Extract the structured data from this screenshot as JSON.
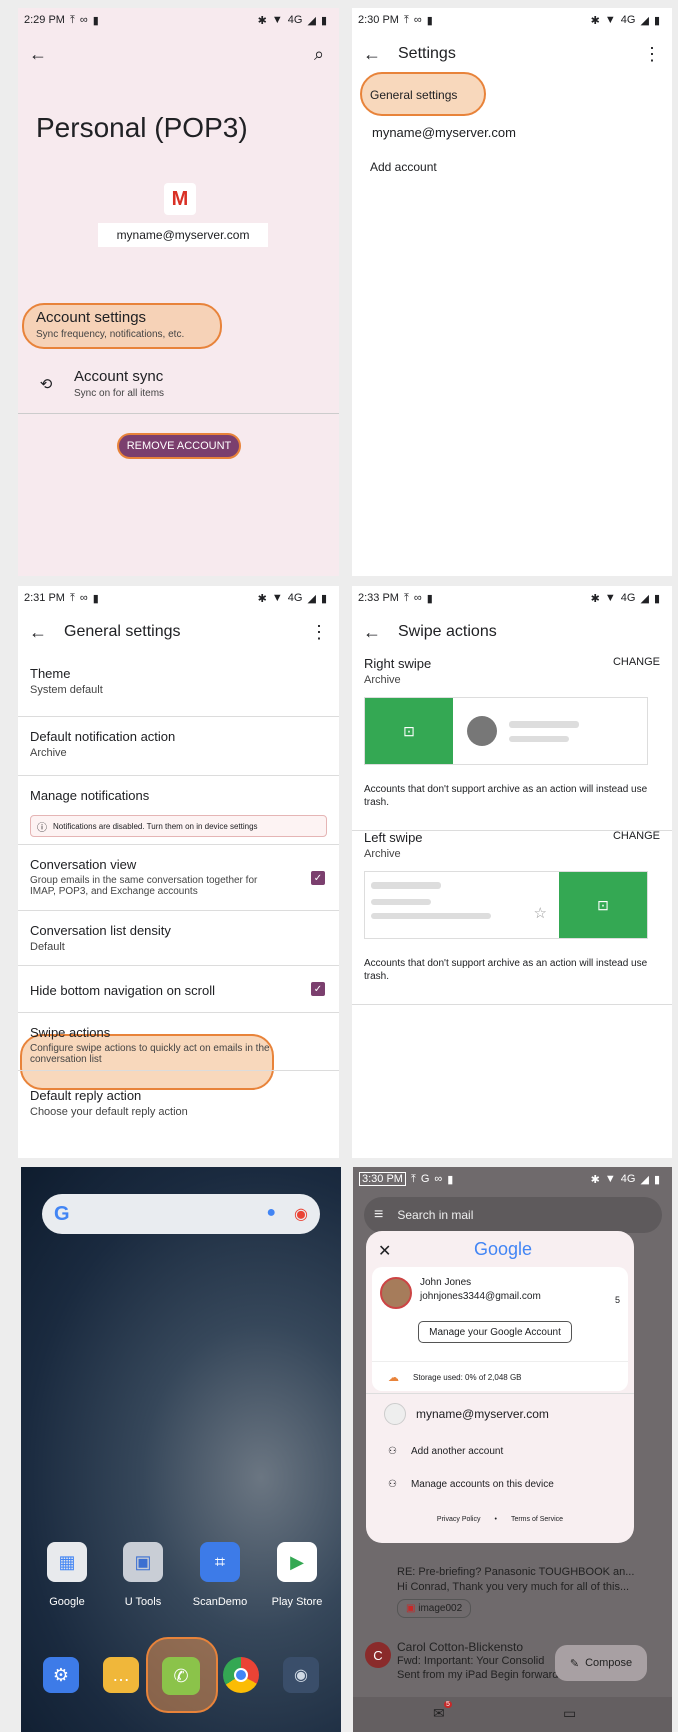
{
  "p1": {
    "time": "2:29 PM",
    "net": "4G",
    "title": "Personal (POP3)",
    "email": "myname@myserver.com",
    "acct_title": "Account settings",
    "acct_sub": "Sync frequency, notifications, etc.",
    "sync_title": "Account sync",
    "sync_sub": "Sync on for all items",
    "remove": "REMOVE ACCOUNT"
  },
  "p2": {
    "time": "2:30 PM",
    "net": "4G",
    "title": "Settings",
    "general": "General settings",
    "email": "myname@myserver.com",
    "add": "Add account"
  },
  "p3": {
    "time": "2:31 PM",
    "net": "4G",
    "title": "General settings",
    "theme": {
      "t": "Theme",
      "s": "System default"
    },
    "notif": {
      "t": "Default notification action",
      "s": "Archive"
    },
    "manage": {
      "t": "Manage notifications",
      "warn": "Notifications are disabled. Turn them on in device settings"
    },
    "conv": {
      "t": "Conversation view",
      "s": "Group emails in the same conversation together for IMAP, POP3, and Exchange accounts"
    },
    "density": {
      "t": "Conversation list density",
      "s": "Default"
    },
    "hide": {
      "t": "Hide bottom navigation on scroll"
    },
    "swipe": {
      "t": "Swipe actions",
      "s": "Configure swipe actions to quickly act on emails in the conversation list"
    },
    "reply": {
      "t": "Default reply action",
      "s": "Choose your default reply action"
    }
  },
  "p4": {
    "time": "2:33 PM",
    "net": "4G",
    "title": "Swipe actions",
    "right": {
      "t": "Right swipe",
      "s": "Archive",
      "change": "CHANGE",
      "note": "Accounts that don't support archive as an action will instead use trash."
    },
    "left": {
      "t": "Left swipe",
      "s": "Archive",
      "change": "CHANGE",
      "note": "Accounts that don't support archive as an action will instead use trash."
    }
  },
  "p5": {
    "apps": [
      "Google",
      "U Tools",
      "ScanDemo",
      "Play Store"
    ]
  },
  "p6": {
    "time": "3:30 PM",
    "net": "4G",
    "search": "Search in mail",
    "google": "Google",
    "name": "John Jones",
    "gmail": "johnjones3344@gmail.com",
    "count": "5",
    "manage_btn": "Manage your Google Account",
    "storage": "Storage used: 0% of 2,048 GB",
    "email": "myname@myserver.com",
    "add": "Add another account",
    "manage_dev": "Manage accounts on this device",
    "privacy": "Privacy Policy",
    "dot": "•",
    "terms": "Terms of Service",
    "bg1a": "RE: Pre-briefing? Panasonic TOUGHBOOK an...",
    "bg1b": "Hi Conrad, Thank you very much for all of this...",
    "attach": "image002",
    "bg2name": "Carol Cotton-Blickensto",
    "bg2a": "Fwd: Important: Your Consolid",
    "bg2b": "Sent from my iPad Begin forwarded message...",
    "compose": "Compose",
    "badge": "5"
  }
}
